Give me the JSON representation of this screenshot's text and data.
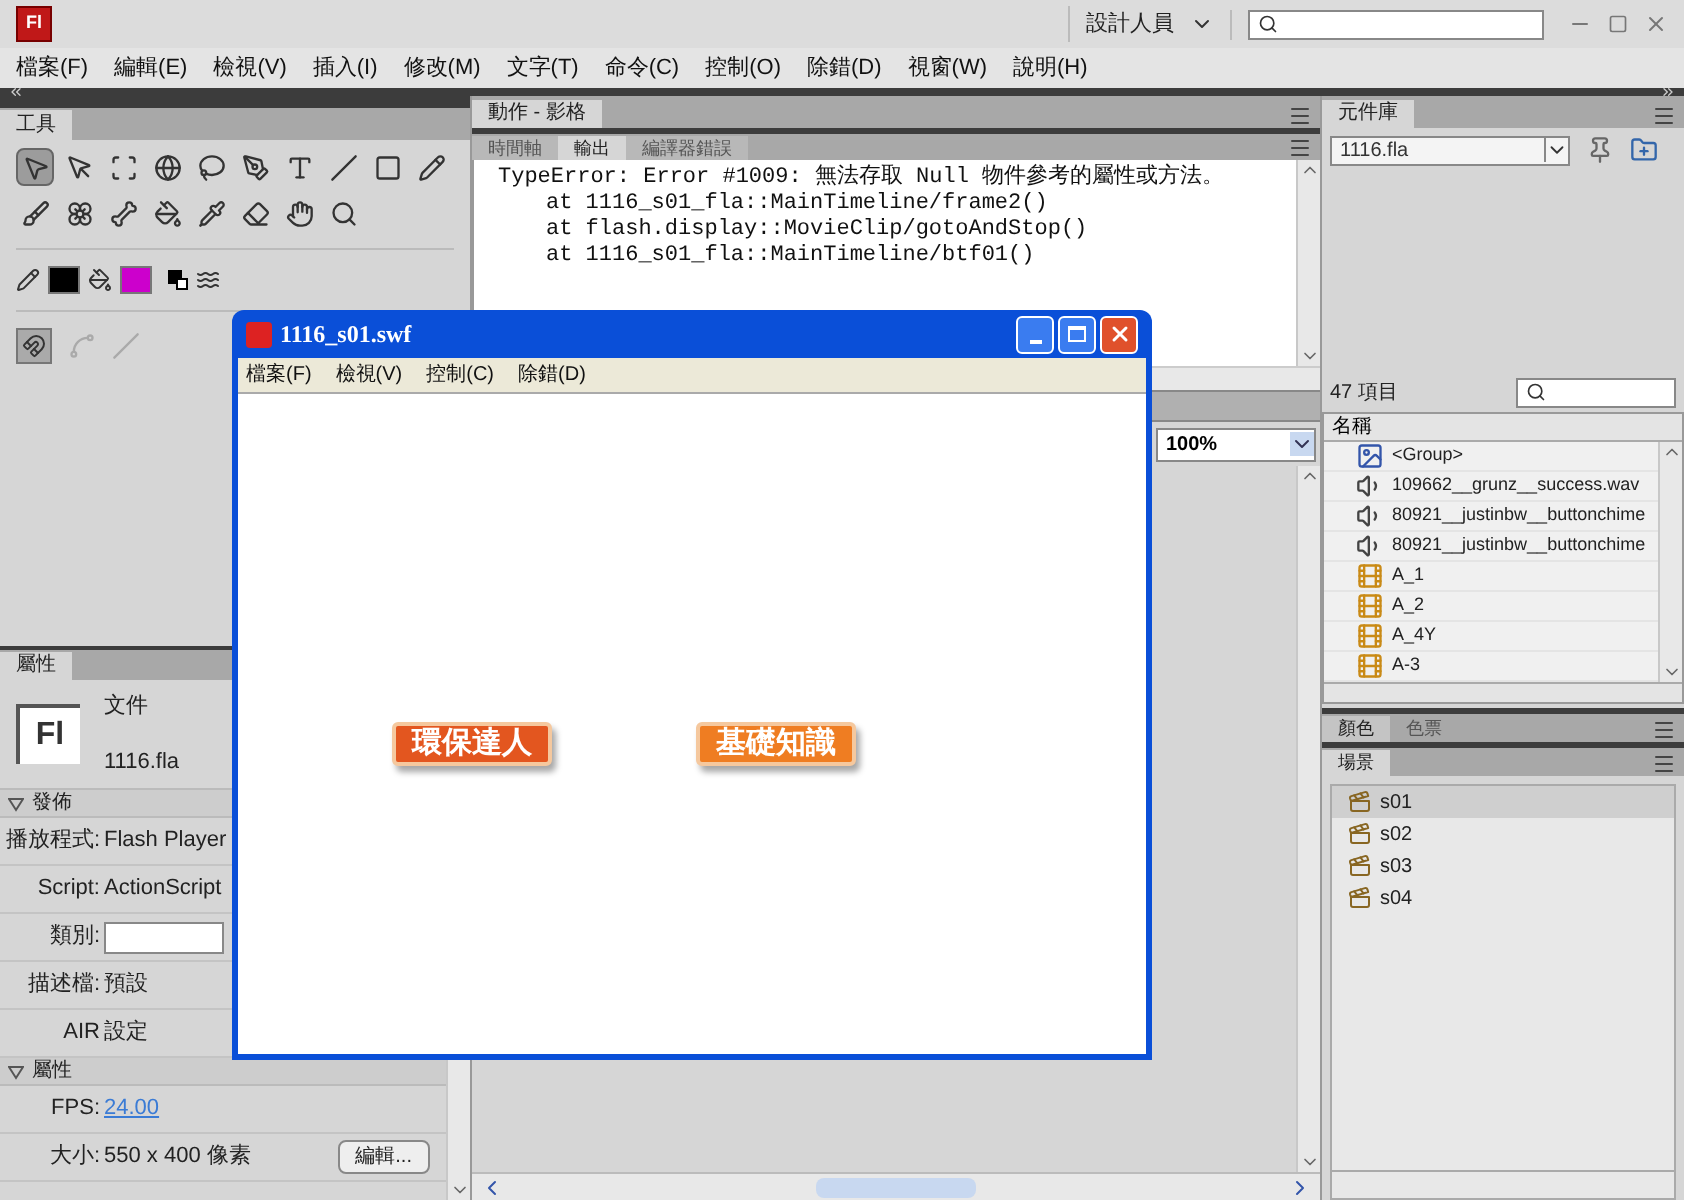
{
  "app_bar": {
    "logo": "Fl",
    "workspace": "設計人員"
  },
  "menu": [
    "檔案(F)",
    "編輯(E)",
    "檢視(V)",
    "插入(I)",
    "修改(M)",
    "文字(T)",
    "命令(C)",
    "控制(O)",
    "除錯(D)",
    "視窗(W)",
    "說明(H)"
  ],
  "tools_panel": {
    "tab": "工具",
    "tool_rows": [
      [
        {
          "selected": true
        },
        {
          "selected": false
        },
        {
          "selected": false
        },
        {
          "selected": false
        },
        {
          "selected": false
        },
        {
          "selected": false
        },
        {
          "selected": false
        },
        {
          "selected": false
        },
        {
          "selected": false
        },
        {
          "selected": false
        }
      ],
      [
        {
          "selected": false
        },
        {
          "selected": false
        },
        {
          "selected": false
        },
        {
          "selected": false
        },
        {
          "selected": false
        },
        {
          "selected": false
        },
        {
          "selected": false
        },
        {
          "selected": false
        }
      ]
    ],
    "swatches": [
      {
        "kind": "stroke",
        "color": "#000000"
      },
      {
        "kind": "fill",
        "color": "#cc00cc"
      }
    ]
  },
  "properties_panel": {
    "tab": "屬性",
    "doc_icon": "Fl",
    "doc_type": "文件",
    "doc_name": "1116.fla",
    "sections": [
      {
        "title": "發佈",
        "expanded": true,
        "rows": [
          {
            "kind": "text",
            "label": "播放程式:",
            "value": "Flash Player"
          },
          {
            "kind": "text",
            "label": "Script:",
            "value": "ActionScript"
          },
          {
            "kind": "input",
            "label": "類別:"
          },
          {
            "kind": "text",
            "label": "描述檔:",
            "value": "預設"
          },
          {
            "kind": "text",
            "label": "AIR",
            "value": "設定"
          }
        ]
      },
      {
        "title": "屬性",
        "expanded": true,
        "rows": [
          {
            "kind": "link",
            "label": "FPS:",
            "value": "24.00"
          },
          {
            "kind": "button",
            "label": "大小:",
            "value": "550 x 400 像素",
            "button": "編輯..."
          }
        ]
      }
    ]
  },
  "actions_tab": "動作 - 影格",
  "output_panel": {
    "tabs": [
      {
        "label": "時間軸",
        "selected": false
      },
      {
        "label": "輸出",
        "selected": true
      },
      {
        "label": "編譯器錯誤",
        "selected": false
      }
    ],
    "lines": [
      {
        "kind": "error",
        "text": "TypeError: Error #1009: 無法存取 Null 物件參考的屬性或方法。"
      },
      {
        "kind": "trace",
        "text": "at 1116_s01_fla::MainTimeline/frame2()"
      },
      {
        "kind": "trace",
        "text": "at flash.display::MovieClip/gotoAndStop()"
      },
      {
        "kind": "trace",
        "text": "at 1116_s01_fla::MainTimeline/btf01()"
      }
    ]
  },
  "stage": {
    "zoom": "100%"
  },
  "library_panel": {
    "tab": "元件庫",
    "file": "1116.fla",
    "count": "47 項目",
    "column": "名稱",
    "items": [
      {
        "kind": "group",
        "name": "<Group>"
      },
      {
        "kind": "sound",
        "name": "109662__grunz__success.wav"
      },
      {
        "kind": "sound",
        "name": "80921__justinbw__buttonchime"
      },
      {
        "kind": "sound",
        "name": "80921__justinbw__buttonchime"
      },
      {
        "kind": "symbol",
        "name": "A_1"
      },
      {
        "kind": "symbol",
        "name": "A_2"
      },
      {
        "kind": "symbol",
        "name": "A_4Y"
      },
      {
        "kind": "symbol",
        "name": "A-3"
      }
    ]
  },
  "color_tabs": [
    {
      "label": "顏色",
      "selected": true
    },
    {
      "label": "色票",
      "selected": false
    }
  ],
  "scene_panel": {
    "tab": "場景",
    "scenes": [
      {
        "name": "s01",
        "selected": true
      },
      {
        "name": "s02",
        "selected": false
      },
      {
        "name": "s03",
        "selected": false
      },
      {
        "name": "s04",
        "selected": false
      }
    ]
  },
  "swf_window": {
    "title": "1116_s01.swf",
    "menu": [
      "檔案(F)",
      "檢視(V)",
      "控制(C)",
      "除錯(D)"
    ],
    "buttons": [
      "環保達人",
      "基礎知識"
    ]
  }
}
